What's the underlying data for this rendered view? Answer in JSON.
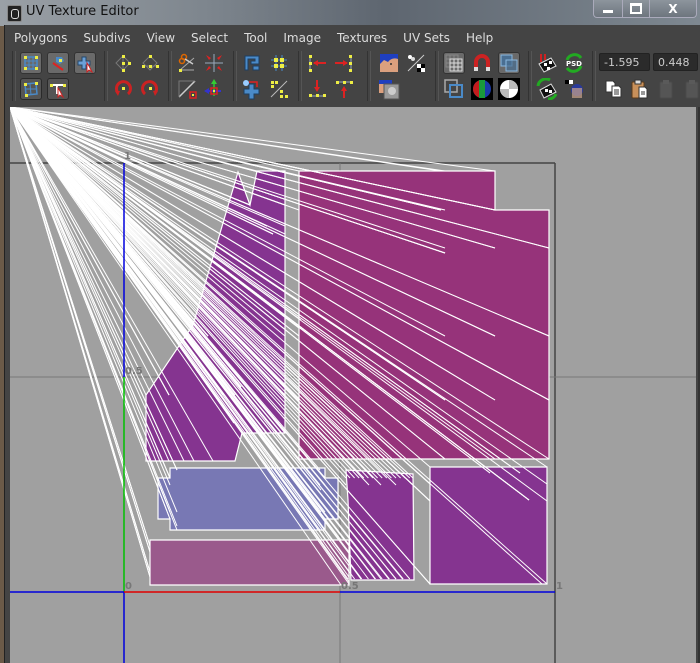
{
  "window": {
    "title": "UV Texture Editor",
    "buttons": {
      "minimize": "—",
      "maximize": "□",
      "close": "X"
    }
  },
  "menubar": {
    "items": [
      "Polygons",
      "Subdivs",
      "View",
      "Select",
      "Tool",
      "Image",
      "Textures",
      "UV Sets",
      "Help"
    ]
  },
  "toolbar": {
    "groups": [
      {
        "name": "selection",
        "icons": [
          "uv-lattice-icon",
          "move-uv-shell-icon",
          "select-shell-icon",
          "uv-smudge-icon",
          "select-edge-loop-icon"
        ]
      },
      {
        "name": "flip-rotate",
        "icons": [
          "flip-u-icon",
          "flip-v-icon",
          "rotate-ccw-icon",
          "rotate-cw-icon"
        ]
      },
      {
        "name": "cut-sew",
        "icons": [
          "cut-uv-edges-icon",
          "sew-uv-edges-icon",
          "split-uvs-icon",
          "move-component-icon"
        ]
      },
      {
        "name": "layout",
        "icons": [
          "layout-uvs-icon",
          "snap-grid-icon",
          "unfold-icon",
          "align-uvs-icon"
        ]
      },
      {
        "name": "align",
        "icons": [
          "align-min-u-icon",
          "align-max-u-icon",
          "align-min-v-icon",
          "align-max-v-icon"
        ]
      },
      {
        "name": "image",
        "icons": [
          "display-image-icon",
          "checker-filter-icon",
          "dim-image-icon"
        ]
      },
      {
        "name": "grid",
        "icons": [
          "toggle-grid-icon",
          "pixel-snap-icon",
          "shaded-uv-icon",
          "texture-borders-icon",
          "rgb-channels-icon",
          "alpha-channel-icon"
        ]
      },
      {
        "name": "psd",
        "icons": [
          "image-ranges-icon",
          "update-psd-icon",
          "refresh-icon",
          "checker-image-icon"
        ]
      },
      {
        "name": "clipboard",
        "icons": [
          "copy-uvs-icon",
          "paste-uvs-icon",
          "paste-u-icon",
          "paste-v-icon"
        ]
      }
    ],
    "u_value": "-1.595",
    "v_value": "0.448"
  },
  "viewport": {
    "axis_labels": {
      "u0": "0",
      "u05": "0.5",
      "u1": "1",
      "v05": "0.5",
      "v1": "1"
    },
    "colors": {
      "background": "#a0a0a0",
      "shell_magenta": "#96337a",
      "shell_purple": "#853490",
      "shell_lavender": "#7878b4",
      "shell_mauve": "#9a5a8c",
      "wire": "#ffffff",
      "u_axis": "#e00000",
      "v_axis": "#00c000",
      "grid_axis": "#0000dd"
    },
    "uv_shells": [
      {
        "name": "tall-left-shell",
        "fill": "shell_purple"
      },
      {
        "name": "large-square-shell",
        "fill": "shell_magenta"
      },
      {
        "name": "lavender-box-shell",
        "fill": "shell_lavender"
      },
      {
        "name": "long-strip-shell",
        "fill": "shell_mauve"
      },
      {
        "name": "dense-cylinder-shell",
        "fill": "shell_purple"
      },
      {
        "name": "small-square-shell",
        "fill": "shell_purple"
      }
    ]
  }
}
